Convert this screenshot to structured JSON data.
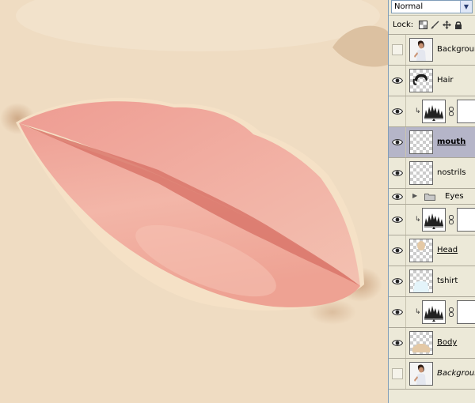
{
  "blend": {
    "mode": "Normal"
  },
  "lock": {
    "label": "Lock:",
    "icons": [
      "transparency-lock-icon",
      "brush-lock-icon",
      "move-lock-icon",
      "padlock-icon"
    ]
  },
  "layers": [
    {
      "name": "Background copy",
      "visible": false,
      "type": "photo"
    },
    {
      "name": "Hair",
      "visible": true,
      "type": "hair"
    },
    {
      "name": "",
      "visible": true,
      "type": "adjustment"
    },
    {
      "name": "mouth",
      "visible": true,
      "type": "empty",
      "selected": true,
      "style": "bold-underline"
    },
    {
      "name": "nostrils",
      "visible": true,
      "type": "empty"
    },
    {
      "name": "Eyes",
      "visible": true,
      "type": "group"
    },
    {
      "name": "",
      "visible": true,
      "type": "adjustment"
    },
    {
      "name": "Head",
      "visible": true,
      "type": "head",
      "style": "underline"
    },
    {
      "name": "tshirt",
      "visible": true,
      "type": "tshirt"
    },
    {
      "name": "",
      "visible": true,
      "type": "adjustment"
    },
    {
      "name": "Body",
      "visible": true,
      "type": "body",
      "style": "underline"
    },
    {
      "name": "Background",
      "visible": false,
      "type": "photo",
      "style": "italic"
    }
  ],
  "colors": {
    "skin": "#efdcc2",
    "lip": "#f0aea0",
    "lip_line": "#d9756a",
    "selected_row": "#b5b5c8"
  }
}
